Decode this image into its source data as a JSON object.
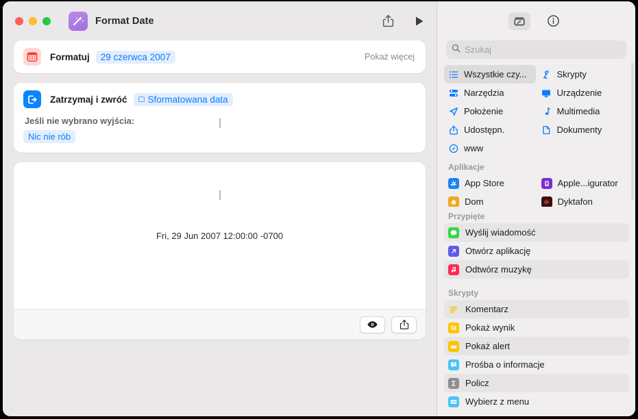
{
  "window": {
    "title": "Format Date",
    "app_icon": "shortcuts-wand-icon",
    "traffic_lights": [
      "close",
      "minimize",
      "zoom"
    ],
    "share_button": "share-icon",
    "run_button": "play-icon"
  },
  "editor": {
    "actions": [
      {
        "icon": "calendar-icon",
        "label": "Formatuj",
        "token": "29 czerwca 2007",
        "trailing": "Pokaż więcej"
      },
      {
        "icon": "stop-and-output-icon",
        "label": "Zatrzymaj i zwróć",
        "token": "Sformatowana data",
        "sub_label": "Jeśli nie wybrano wyjścia:",
        "sub_token": "Nic nie rób"
      }
    ],
    "result": {
      "text": "Fri, 29 Jun 2007 12:00:00 -0700",
      "quicklook_button": "eye-icon",
      "share_button": "share-icon"
    }
  },
  "library": {
    "toolbar": {
      "actions_button": "action-library-icon",
      "info_button": "info-circle-icon"
    },
    "search": {
      "placeholder": "Szukaj",
      "value": "",
      "icon": "search-icon"
    },
    "categories": [
      {
        "label": "Wszystkie czy...",
        "icon": "list-bullet-icon",
        "selected": true
      },
      {
        "label": "Skrypty",
        "icon": "scripting-icon",
        "selected": false
      },
      {
        "label": "Narzędzia",
        "icon": "tools-icon",
        "selected": false
      },
      {
        "label": "Urządzenie",
        "icon": "display-icon",
        "selected": false
      },
      {
        "label": "Położenie",
        "icon": "location-arrow-icon",
        "selected": false
      },
      {
        "label": "Multimedia",
        "icon": "music-note-icon",
        "selected": false
      },
      {
        "label": "Udostępn.",
        "icon": "share-icon",
        "selected": false
      },
      {
        "label": "Dokumenty",
        "icon": "document-icon",
        "selected": false
      },
      {
        "label": "www",
        "icon": "safari-compass-icon",
        "selected": false
      }
    ],
    "apps_section": {
      "title": "Aplikacje",
      "items": [
        {
          "label": "App Store",
          "icon": "app-store-icon",
          "color": "#1d82f5"
        },
        {
          "label": "Apple...igurator",
          "icon": "apple-configurator-icon",
          "color": "#7b2fd1"
        },
        {
          "label": "Dom",
          "icon": "home-icon",
          "color": "#f5a623"
        },
        {
          "label": "Dyktafon",
          "icon": "voice-memos-icon",
          "color": "#3a1010"
        }
      ]
    },
    "pinned_section": {
      "title": "Przypięte",
      "items": [
        {
          "label": "Wyślij wiadomość",
          "icon": "messages-icon",
          "color": "#32d74b"
        },
        {
          "label": "Otwórz aplikację",
          "icon": "open-app-icon",
          "color": "#5e5ce6"
        },
        {
          "label": "Odtwórz muzykę",
          "icon": "music-icon",
          "color": "#fa2b55"
        }
      ]
    },
    "scripts_section": {
      "title": "Skrypty",
      "items": [
        {
          "label": "Komentarz",
          "icon": "comment-icon",
          "color": "#ffffff"
        },
        {
          "label": "Pokaż wynik",
          "icon": "show-result-icon",
          "color": "#ffc300"
        },
        {
          "label": "Pokaż alert",
          "icon": "show-alert-icon",
          "color": "#ffc300"
        },
        {
          "label": "Prośba o informacje",
          "icon": "ask-for-input-icon",
          "color": "#4cc3f7"
        },
        {
          "label": "Policz",
          "icon": "count-sigma-icon",
          "color": "#8e8e93"
        },
        {
          "label": "Wybierz z menu",
          "icon": "choose-from-menu-icon",
          "color": "#4cc3f7"
        }
      ]
    }
  },
  "colors": {
    "accent_blue": "#0a7cff",
    "window_bg": "#eae8e8",
    "sidebar_bg": "#f0eeee",
    "card_bg": "#ffffff",
    "token_bg": "#e3eefc"
  }
}
